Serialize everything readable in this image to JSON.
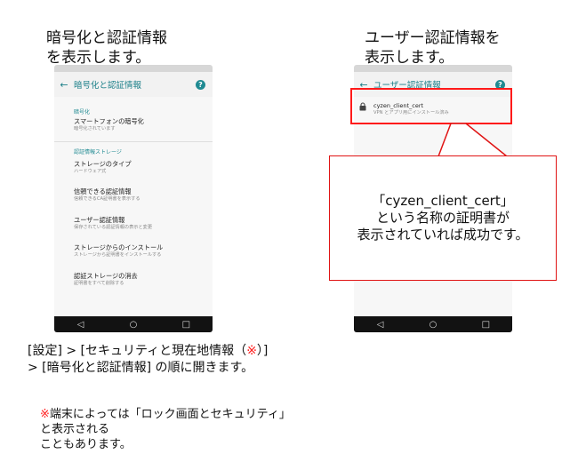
{
  "left_caption": {
    "line1": "暗号化と認証情報",
    "line2": "を表示します。"
  },
  "right_caption": {
    "line1": "ユーザー認証情報を",
    "line2": "表示します。"
  },
  "left_phone": {
    "appbar_title": "暗号化と認証情報",
    "sections": [
      {
        "header": "暗号化",
        "items": [
          {
            "title": "スマートフォンの暗号化",
            "subtitle": "暗号化されています"
          }
        ]
      },
      {
        "header": "認証情報ストレージ",
        "items": [
          {
            "title": "ストレージのタイプ",
            "subtitle": "ハードウェア式"
          },
          {
            "title": "信頼できる認証情報",
            "subtitle": "信頼できるCA証明書を表示する"
          },
          {
            "title": "ユーザー認証情報",
            "subtitle": "保存されている認証情報の表示と変更"
          },
          {
            "title": "ストレージからのインストール",
            "subtitle": "ストレージから証明書をインストールする"
          },
          {
            "title": "認証ストレージの消去",
            "subtitle": "証明書をすべて削除する"
          }
        ]
      }
    ]
  },
  "right_phone": {
    "appbar_title": "ユーザー認証情報",
    "cert": {
      "name": "cyzen_client_cert",
      "subtitle": "VPN とアプリ用にインストール済み"
    }
  },
  "nav": {
    "back": "◁",
    "home": "○",
    "recent": "□"
  },
  "help_glyph": "?",
  "back_glyph": "←",
  "callout": {
    "line1": "「cyzen_client_cert」",
    "line2": "という名称の証明書が",
    "line3": "表示されていれば成功です。"
  },
  "instruction": {
    "line1_pre": "[設定] > [セキュリティと現在地情報（",
    "line1_mark": "※",
    "line1_post": "）]",
    "line2": "> [暗号化と認証情報] の順に開きます。"
  },
  "note": {
    "mark": "※",
    "line1": "端末によっては「ロック画面とセキュリティ」",
    "line2": "と表示される",
    "line3": "こともあります。"
  },
  "colors": {
    "accent": "#1f8a92",
    "highlight": "#ff1a1a",
    "note_red": "#ff2020"
  }
}
